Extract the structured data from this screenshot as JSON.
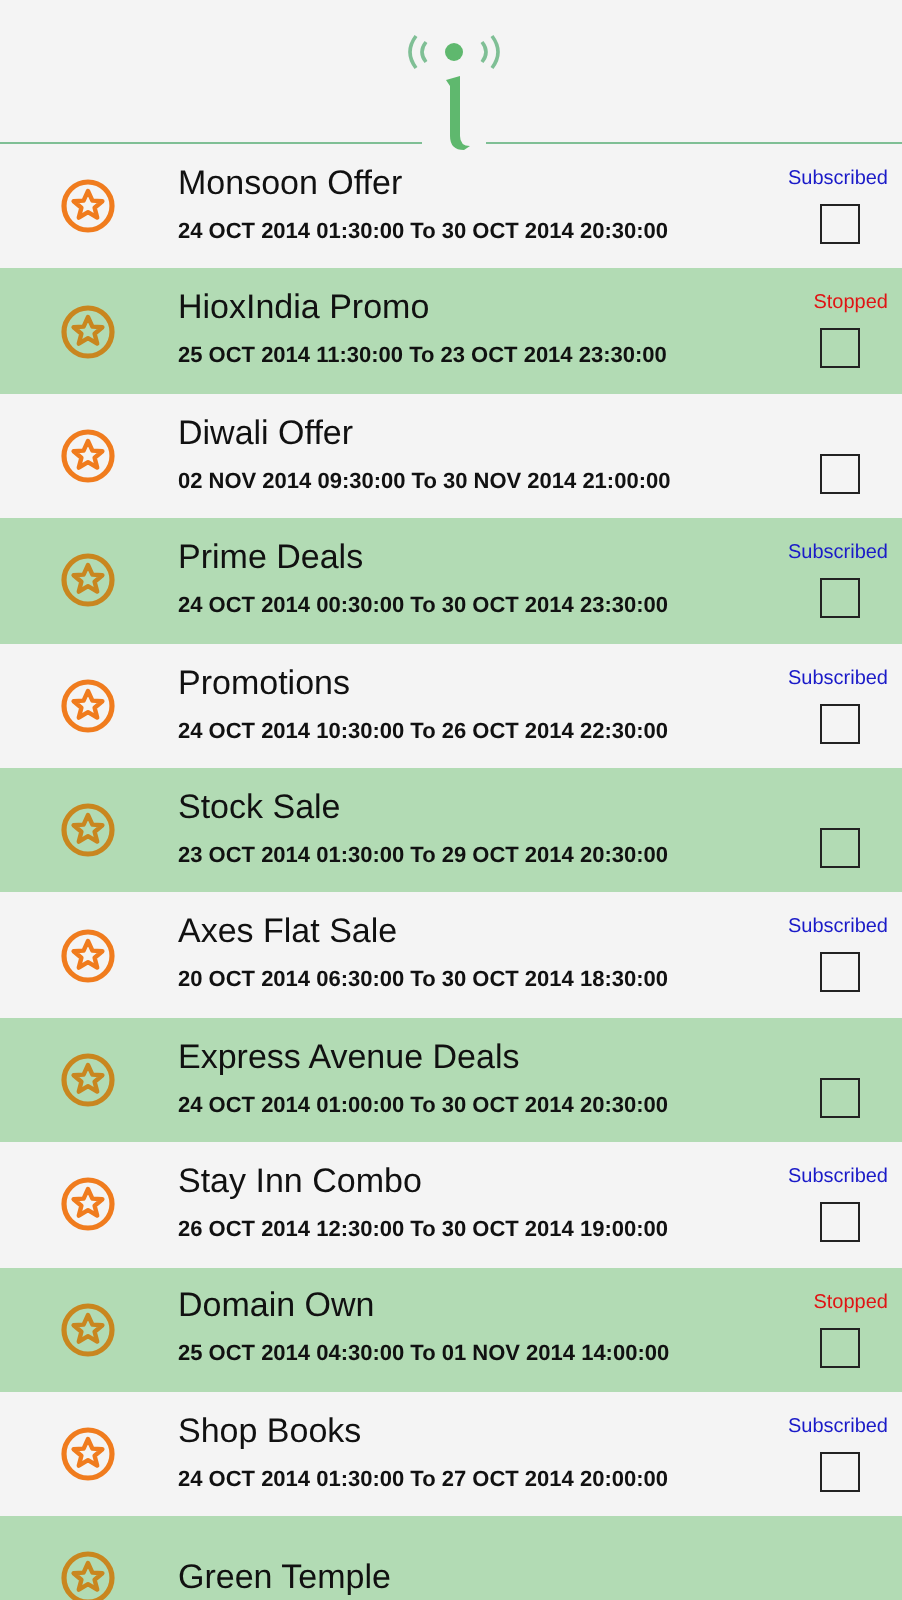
{
  "offers": [
    {
      "title": "Monsoon Offer",
      "period": "24 OCT 2014 01:30:00 To 30 OCT 2014 20:30:00",
      "status": "Subscribed",
      "color": "#1a1ac8",
      "checked": false
    },
    {
      "title": "HioxIndia Promo",
      "period": "25 OCT 2014 11:30:00 To 23 OCT 2014 23:30:00",
      "status": "Stopped",
      "color": "#e01414",
      "checked": false
    },
    {
      "title": "Diwali Offer",
      "period": "02 NOV 2014 09:30:00 To 30 NOV 2014 21:00:00",
      "checked": false
    },
    {
      "title": "Prime Deals",
      "period": "24 OCT 2014 00:30:00 To 30 OCT 2014 23:30:00",
      "status": "Subscribed",
      "color": "#1a1ac8",
      "checked": false
    },
    {
      "title": "Promotions",
      "period": "24 OCT 2014 10:30:00 To 26 OCT 2014 22:30:00",
      "status": "Subscribed",
      "color": "#1a1ac8",
      "checked": false
    },
    {
      "title": "Stock Sale",
      "period": "23 OCT 2014 01:30:00 To 29 OCT 2014 20:30:00",
      "checked": false
    },
    {
      "title": "Axes Flat Sale",
      "period": "20 OCT 2014 06:30:00 To 30 OCT 2014 18:30:00",
      "status": "Subscribed",
      "color": "#1a1ac8",
      "checked": false
    },
    {
      "title": "Express Avenue Deals",
      "period": "24 OCT 2014 01:00:00 To 30 OCT 2014 20:30:00",
      "checked": false
    },
    {
      "title": "Stay Inn Combo",
      "period": "26 OCT 2014 12:30:00 To 30 OCT 2014 19:00:00",
      "status": "Subscribed",
      "color": "#1a1ac8",
      "checked": false
    },
    {
      "title": "Domain Own",
      "period": "25 OCT 2014 04:30:00 To 01 NOV 2014 14:00:00",
      "status": "Stopped",
      "color": "#e01414",
      "checked": false
    },
    {
      "title": "Shop Books",
      "period": "24 OCT 2014 01:30:00 To 27 OCT 2014 20:00:00",
      "status": "Subscribed",
      "color": "#1a1ac8",
      "checked": false
    },
    {
      "title": "Green Temple"
    }
  ]
}
